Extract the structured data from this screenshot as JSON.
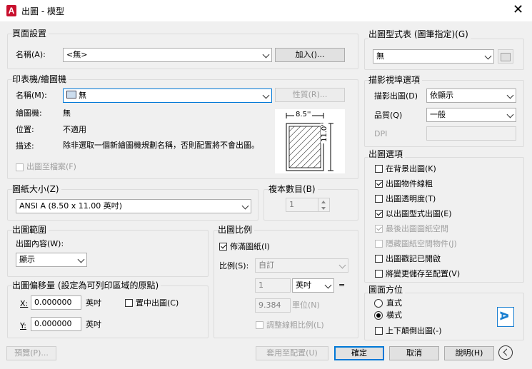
{
  "window": {
    "title": "出圖 - 模型",
    "app_icon_letter": "A"
  },
  "page_setup": {
    "group": "頁面設置",
    "name_label": "名稱(A):",
    "name_value": "<無>",
    "add_button": "加入()..."
  },
  "printer": {
    "group": "印表機/繪圖機",
    "name_label": "名稱(M):",
    "name_value": "無",
    "properties_button": "性質(R)...",
    "plotter_label": "繪圖機:",
    "plotter_value": "無",
    "location_label": "位置:",
    "location_value": "不適用",
    "desc_label": "描述:",
    "desc_value": "除非選取一個新繪圖機規劃名稱，否則配置將不會出圖。",
    "plot_to_file": "出圖至檔案(F)",
    "preview_width": "8.5''",
    "preview_height": "11.0''"
  },
  "paper": {
    "group": "圖紙大小(Z)",
    "value": "ANSI A (8.50 x 11.00 英吋)"
  },
  "copies": {
    "group": "複本數目(B)",
    "value": "1"
  },
  "plot_area": {
    "group": "出圖範圍",
    "what_label": "出圖內容(W):",
    "what_value": "顯示"
  },
  "offset": {
    "group": "出圖偏移量 (設定為可列印區域的原點)",
    "x_label": "X:",
    "x_value": "0.000000",
    "x_unit": "英吋",
    "y_label": "Y:",
    "y_value": "0.000000",
    "y_unit": "英吋",
    "center": "置中出圖(C)"
  },
  "scale": {
    "group": "出圖比例",
    "fit": "佈滿圖紙(I)",
    "scale_label": "比例(S):",
    "scale_value": "自訂",
    "num_value": "1",
    "unit_value": "英吋",
    "equals": "=",
    "den_value": "9.384",
    "den_unit": "單位(N)",
    "lineweights": "調整線粗比例(L)"
  },
  "style_table": {
    "group": "出圖型式表 (圖筆指定)(G)",
    "value": "無"
  },
  "viewport": {
    "group": "描影視埠選項",
    "shade_label": "描影出圖(D)",
    "shade_value": "依顯示",
    "quality_label": "品質(Q)",
    "quality_value": "一般",
    "dpi_label": "DPI"
  },
  "options": {
    "group": "出圖選項",
    "items": [
      "在背景出圖(K)",
      "出圖物件線粗",
      "出圖透明度(T)",
      "以出圖型式出圖(E)",
      "最後出圖圖紙空間",
      "隱藏圖紙空間物件(J)",
      "出圖戳記已開啟",
      "將變更儲存至配置(V)"
    ]
  },
  "orientation": {
    "group": "圖面方位",
    "portrait": "直式",
    "landscape": "橫式",
    "upside": "上下顛倒出圖(-)",
    "icon_letter": "A"
  },
  "footer": {
    "preview": "預覽(P)...",
    "apply": "套用至配置(U)",
    "ok": "確定",
    "cancel": "取消",
    "help": "說明(H)"
  }
}
